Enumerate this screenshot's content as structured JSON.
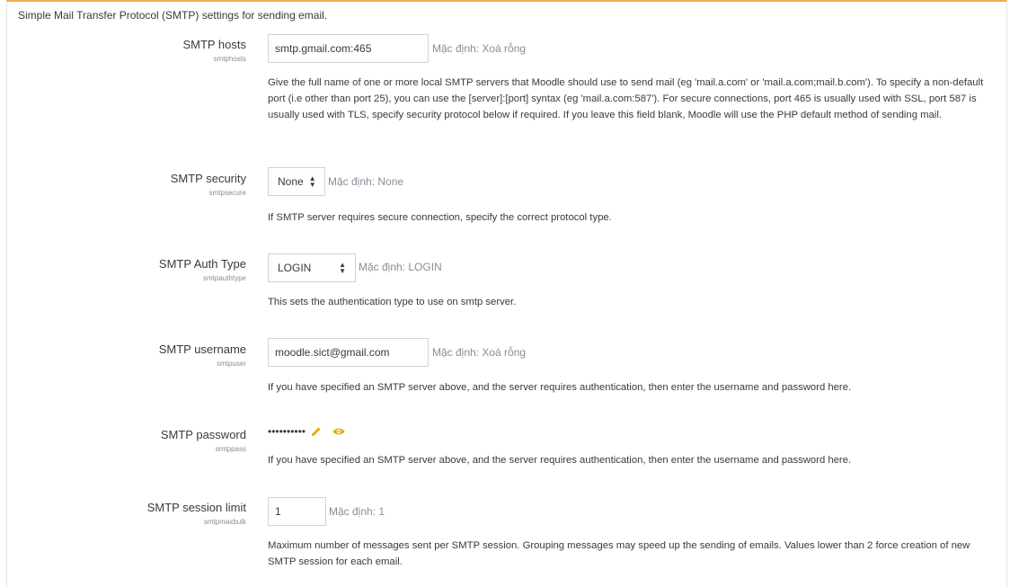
{
  "intro": "Simple Mail Transfer Protocol (SMTP) settings for sending email.",
  "settings": [
    {
      "label": "SMTP hosts",
      "name": "smtphosts",
      "value": "smtp.gmail.com:465",
      "default": "Mặc định: Xoá rỗng",
      "description": "Give the full name of one or more local SMTP servers that Moodle should use to send mail (eg 'mail.a.com' or 'mail.a.com;mail.b.com'). To specify a non-default port (i.e other than port 25), you can use the [server]:[port] syntax (eg 'mail.a.com:587'). For secure connections, port 465 is usually used with SSL, port 587 is usually used with TLS, specify security protocol below if required. If you leave this field blank, Moodle will use the PHP default method of sending mail."
    },
    {
      "label": "SMTP security",
      "name": "smtpsecure",
      "value": "None",
      "default": "Mặc định: None",
      "description": "If SMTP server requires secure connection, specify the correct protocol type."
    },
    {
      "label": "SMTP Auth Type",
      "name": "smtpauthtype",
      "value": "LOGIN",
      "default": "Mặc định: LOGIN",
      "description": "This sets the authentication type to use on smtp server."
    },
    {
      "label": "SMTP username",
      "name": "smtpuser",
      "value": "moodle.sict@gmail.com",
      "default": "Mặc định: Xoá rỗng",
      "description": "If you have specified an SMTP server above, and the server requires authentication, then enter the username and password here."
    },
    {
      "label": "SMTP password",
      "name": "smtppass",
      "value": "••••••••••",
      "description": "If you have specified an SMTP server above, and the server requires authentication, then enter the username and password here.",
      "icons": [
        "pencil-icon",
        "eye-icon"
      ]
    },
    {
      "label": "SMTP session limit",
      "name": "smtpmaxbulk",
      "value": "1",
      "default": "Mặc định: 1",
      "description": "Maximum number of messages sent per SMTP session. Grouping messages may speed up the sending of emails. Values lower than 2 force creation of new SMTP session for each email."
    }
  ],
  "colors": {
    "accent": "#f0ad4e",
    "icon": "#e8a800",
    "muted": "#868e96"
  }
}
